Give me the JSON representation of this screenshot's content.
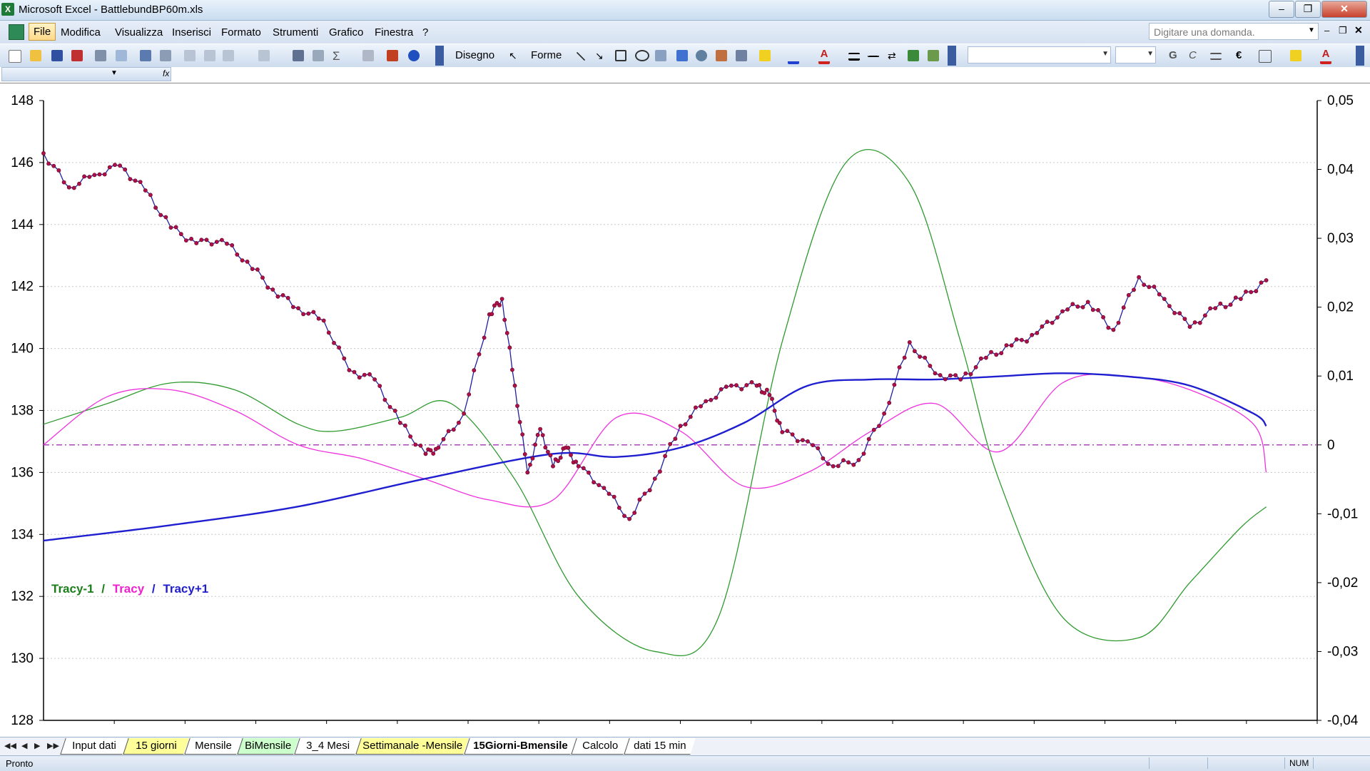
{
  "window": {
    "title": "Microsoft Excel - BattlebundBP60m.xls",
    "controls": {
      "minimize": "–",
      "restore": "❐",
      "close": "✕"
    }
  },
  "menubar": {
    "items": [
      "File",
      "Modifica",
      "Visualizza",
      "Inserisci",
      "Formato",
      "Strumenti",
      "Grafico",
      "Finestra",
      "?"
    ],
    "ask_placeholder": "Digitare una domanda."
  },
  "toolbar": {
    "draw_label": "Disegno",
    "shapes_label": "Forme",
    "bold": "G",
    "italic": "C",
    "euro": "€",
    "sigma": "Σ",
    "fx": "fx"
  },
  "chart": {
    "legend": [
      {
        "label": "Tracy-1",
        "color": "#1a7f1a"
      },
      {
        "label": "Tracy",
        "color": "#ee22cc"
      },
      {
        "label": "Tracy+1",
        "color": "#1f1fcc"
      }
    ],
    "legend_separator": "/",
    "left_ticks": [
      "148",
      "146",
      "144",
      "142",
      "140",
      "138",
      "136",
      "134",
      "132",
      "130",
      "128"
    ],
    "right_ticks": [
      "0,05",
      "0,04",
      "0,03",
      "0,02",
      "0,01",
      "0",
      "-0,01",
      "-0,02",
      "-0,03",
      "-0,04"
    ]
  },
  "chart_data": {
    "type": "line",
    "grid": true,
    "y_left_range": [
      128,
      148
    ],
    "y_right_range": [
      -0.04,
      0.05
    ],
    "price_color": "#1f1fa0",
    "marker_color": "#b0104a",
    "reference_line": {
      "axis": "right",
      "value": 0,
      "color": "#b040c0"
    },
    "series": [
      {
        "name": "Tracy-1",
        "axis": "right",
        "color": "#2e9a2e",
        "x": [
          0,
          5,
          10,
          15,
          20,
          23,
          28,
          32,
          37,
          42,
          48,
          53,
          58,
          63,
          68,
          72,
          75,
          80,
          86,
          90,
          94,
          96
        ],
        "values": [
          0.003,
          0.006,
          0.009,
          0.008,
          0.003,
          0.002,
          0.004,
          0.006,
          -0.005,
          -0.022,
          -0.03,
          -0.025,
          0.015,
          0.041,
          0.038,
          0.015,
          -0.005,
          -0.025,
          -0.028,
          -0.02,
          -0.012,
          -0.009
        ]
      },
      {
        "name": "Tracy",
        "axis": "right",
        "color": "#ee33dd",
        "x": [
          0,
          5,
          10,
          15,
          20,
          25,
          30,
          35,
          40,
          45,
          50,
          55,
          60,
          65,
          70,
          75,
          80,
          85,
          90,
          95,
          96
        ],
        "values": [
          0.0,
          0.007,
          0.008,
          0.005,
          0.0,
          -0.002,
          -0.005,
          -0.008,
          -0.008,
          0.004,
          0.002,
          -0.006,
          -0.004,
          0.002,
          0.006,
          -0.001,
          0.009,
          0.01,
          0.008,
          0.003,
          -0.004
        ]
      },
      {
        "name": "Tracy+1",
        "axis": "left",
        "color": "#1f1fd0",
        "x": [
          0,
          10,
          20,
          30,
          40,
          45,
          50,
          55,
          60,
          65,
          70,
          75,
          80,
          85,
          90,
          95,
          96
        ],
        "values": [
          133.8,
          134.3,
          134.9,
          135.8,
          136.6,
          136.5,
          136.8,
          137.6,
          138.8,
          139.0,
          139.0,
          139.1,
          139.2,
          139.1,
          138.8,
          137.9,
          137.5
        ]
      },
      {
        "name": "",
        "axis": "left",
        "color": "#1f1fa0",
        "x": [
          0,
          2,
          4,
          6,
          8,
          10,
          12,
          14,
          16,
          18,
          20,
          22,
          24,
          26,
          28,
          30,
          31,
          33,
          35,
          36,
          37,
          38,
          39,
          40,
          41,
          42,
          44,
          46,
          48,
          50,
          52,
          54,
          56,
          57,
          58,
          60,
          62,
          64,
          66,
          68,
          70,
          72,
          74,
          76,
          78,
          80,
          82,
          84,
          86,
          88,
          90,
          92,
          94,
          96
        ],
        "values": [
          146.3,
          145.2,
          145.6,
          145.9,
          145.1,
          143.9,
          143.4,
          143.5,
          142.8,
          141.9,
          141.3,
          140.9,
          139.3,
          139.0,
          137.6,
          136.6,
          136.8,
          137.9,
          141.1,
          141.6,
          138.8,
          136.0,
          137.4,
          136.2,
          136.8,
          136.2,
          135.5,
          134.5,
          135.8,
          137.5,
          138.3,
          138.8,
          138.8,
          138.5,
          137.3,
          137.0,
          136.2,
          136.4,
          137.9,
          140.2,
          139.2,
          139.0,
          139.7,
          140.1,
          140.5,
          141.2,
          141.5,
          140.6,
          142.3,
          141.6,
          140.7,
          141.3,
          141.6,
          142.2
        ]
      }
    ]
  },
  "sheet_tabs": {
    "nav": [
      "◀◀",
      "◀",
      "▶",
      "▶▶"
    ],
    "tabs": [
      {
        "label": "Input dati",
        "color": "#ffffff",
        "active": false
      },
      {
        "label": "15 giorni",
        "color": "#ffff99",
        "active": false
      },
      {
        "label": "Mensile",
        "color": "#ffffff",
        "active": false
      },
      {
        "label": "BiMensile",
        "color": "#ccffcc",
        "active": false
      },
      {
        "label": "3_4 Mesi",
        "color": "#ffffff",
        "active": false
      },
      {
        "label": "Settimanale -Mensile",
        "color": "#ffff99",
        "active": false
      },
      {
        "label": "15Giorni-Bmensile",
        "color": "#ffffff",
        "active": true
      },
      {
        "label": "Calcolo",
        "color": "#ffffff",
        "active": false
      },
      {
        "label": "dati 15 min",
        "color": "#ffffff",
        "active": false
      }
    ]
  },
  "statusbar": {
    "status": "Pronto",
    "num": "NUM"
  }
}
